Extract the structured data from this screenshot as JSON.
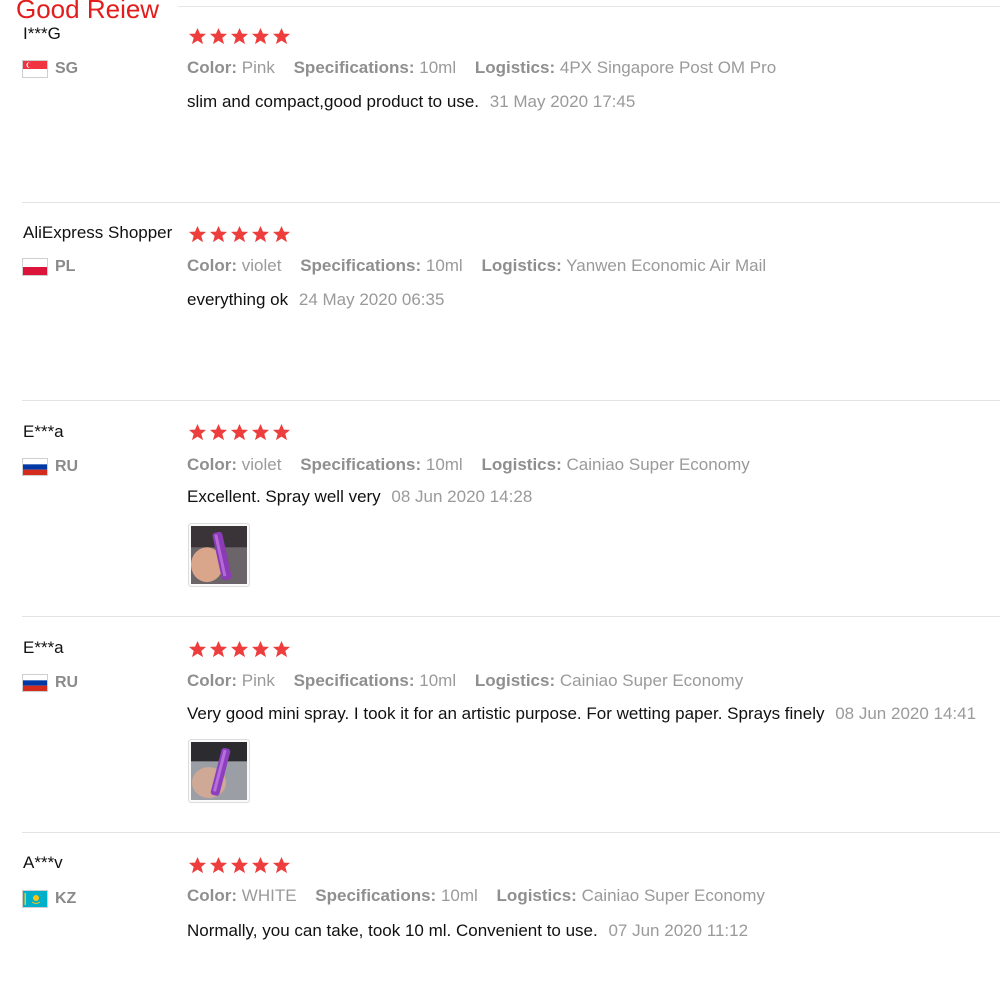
{
  "section_title": "Good Reiew",
  "labels": {
    "color": "Color:",
    "specifications": "Specifications:",
    "logistics": "Logistics:"
  },
  "reviews": [
    {
      "user": "I***G",
      "country": "SG",
      "rating": 5,
      "color": "Pink",
      "specifications": "10ml",
      "logistics": "4PX Singapore Post OM Pro",
      "comment": "slim and compact,good product to use.",
      "date": "31 May 2020 17:45"
    },
    {
      "user": "AliExpress Shopper",
      "country": "PL",
      "rating": 5,
      "color": "violet",
      "specifications": "10ml",
      "logistics": "Yanwen Economic Air Mail",
      "comment": "everything ok",
      "date": "24 May 2020 06:35"
    },
    {
      "user": "E***a",
      "country": "RU",
      "rating": 5,
      "color": "violet",
      "specifications": "10ml",
      "logistics": "Cainiao Super Economy",
      "comment": "Excellent. Spray well very",
      "date": "08 Jun 2020 14:28"
    },
    {
      "user": "E***a",
      "country": "RU",
      "rating": 5,
      "color": "Pink",
      "specifications": "10ml",
      "logistics": "Cainiao Super Economy",
      "comment": "Very good mini spray. I took it for an artistic purpose. For wetting paper. Sprays finely",
      "date": "08 Jun 2020 14:41"
    },
    {
      "user": "A***v",
      "country": "KZ",
      "rating": 5,
      "color": "WHITE",
      "specifications": "10ml",
      "logistics": "Cainiao Super Economy",
      "comment": "Normally, you can take, took 10 ml. Convenient to use.",
      "date": "07 Jun 2020 11:12"
    }
  ],
  "colors": {
    "star": "#ee3d3d",
    "title": "#e31c1c"
  }
}
